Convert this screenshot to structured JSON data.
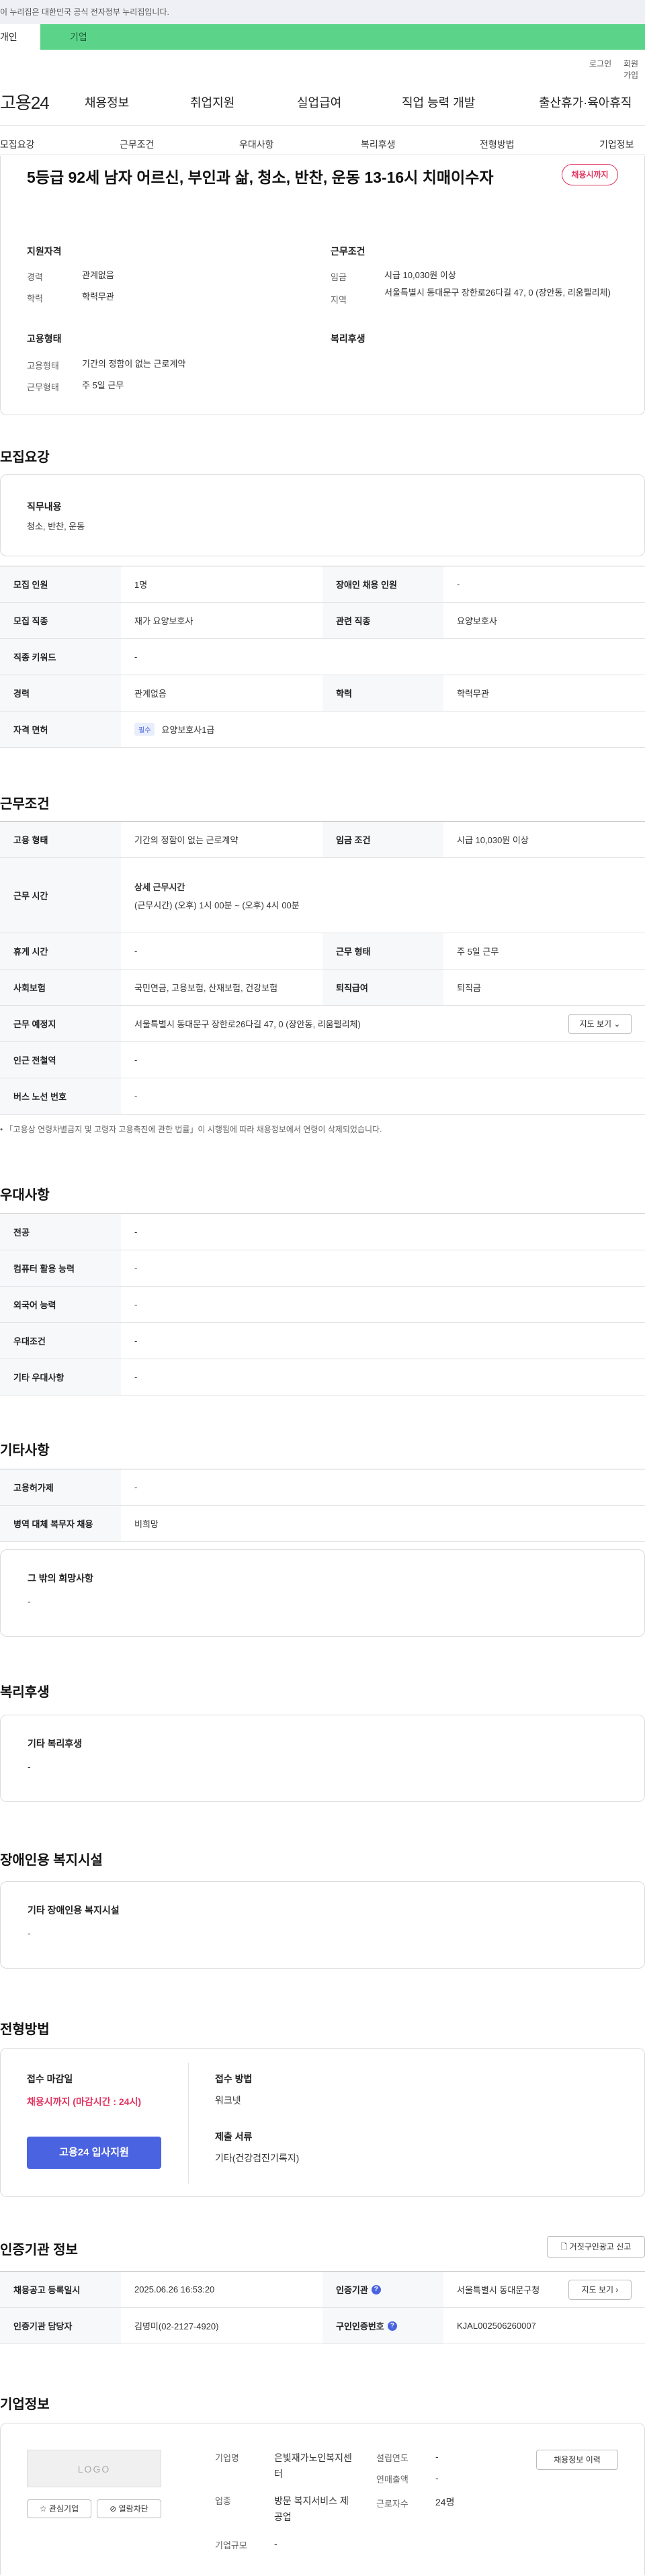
{
  "gov_banner": "이 누리집은 대한민국 공식 전자정부 누리집입니다.",
  "top_tabs": {
    "individual": "개인",
    "business": "기업"
  },
  "util": {
    "login": "로그인",
    "join": "회원가입"
  },
  "logo_text": "고용24",
  "gnb": [
    "채용정보",
    "취업지원",
    "실업급여",
    "직업 능력 개발",
    "출산휴가·육아휴직"
  ],
  "anchors": [
    "모집요강",
    "근무조건",
    "우대사항",
    "복리후생",
    "전형방법",
    "기업정보"
  ],
  "header": {
    "title": "5등급 92세 남자 어르신, 부인과 삶, 청소, 반찬, 운동 13-16시 치매이수자",
    "status_badge": "채용시까지",
    "qualification_title": "지원자격",
    "career_label": "경력",
    "career_value": "관계없음",
    "education_label": "학력",
    "education_value": "학력무관",
    "work_cond_title": "근무조건",
    "wage_label": "임금",
    "wage_value": "시급 10,030원 이상",
    "area_label": "지역",
    "area_value": "서울특별시 동대문구 장한로26다길 47, 0 (장안동, 리움펠리체)",
    "employ_type_title": "고용형태",
    "employ_label": "고용형태",
    "employ_value": "기간의 정함이 없는 근로계약",
    "workform_label": "근무형태",
    "workform_value": "주 5일 근무",
    "welfare_title": "복리후생"
  },
  "recruit": {
    "section": "모집요강",
    "duty_label": "직무내용",
    "duty_value": "청소, 반찬, 운동",
    "rows": [
      {
        "l1": "모집 인원",
        "v1": "1명",
        "l2": "장애인 채용 인원",
        "v2": "-"
      },
      {
        "l1": "모집 직종",
        "v1": "재가 요양보호사",
        "l2": "관련 직종",
        "v2": "요양보호사"
      },
      {
        "l1": "직종 키워드",
        "v1": "-"
      },
      {
        "l1": "경력",
        "v1": "관계없음",
        "l2": "학력",
        "v2": "학력무관"
      },
      {
        "l1": "자격 면허",
        "badge": "필수",
        "v1": "요양보호사1급"
      }
    ]
  },
  "conditions": {
    "section": "근무조건",
    "employ_type_label": "고용 형태",
    "employ_type_value": "기간의 정함이 없는 근로계약",
    "wage_cond_label": "임금 조건",
    "wage_cond_value": "시급 10,030원 이상",
    "hours_label": "근무 시간",
    "hours_detail_title": "상세 근무시간",
    "hours_detail_value": "(근무시간) (오후) 1시 00분 ~ (오후) 4시 00분",
    "rest_label": "휴게 시간",
    "rest_value": "-",
    "workform_label": "근무 형태",
    "workform_value": "주 5일 근무",
    "insurance_label": "사회보험",
    "insurance_value": "국민연금, 고용보험, 산재보험, 건강보험",
    "severance_label": "퇴직급여",
    "severance_value": "퇴직금",
    "location_label": "근무 예정지",
    "location_value": "서울특별시 동대문구 장한로26다길 47, 0 (장안동, 리움펠리체)",
    "map_button": "지도 보기",
    "subway_label": "인근 전철역",
    "subway_value": "-",
    "bus_label": "버스 노선 번호",
    "bus_value": "-",
    "note": "「고용상 연령차별금지 및 고령자 고용촉진에 관한 법률」이 시행됨에 따라 채용정보에서 연령이 삭제되었습니다."
  },
  "preference": {
    "section": "우대사항",
    "rows": [
      {
        "l": "전공",
        "v": "-"
      },
      {
        "l": "컴퓨터 활용 능력",
        "v": "-"
      },
      {
        "l": "외국어 능력",
        "v": "-"
      },
      {
        "l": "우대조건",
        "v": "-"
      },
      {
        "l": "기타 우대사항",
        "v": "-"
      }
    ]
  },
  "etc": {
    "section": "기타사항",
    "rows": [
      {
        "l": "고용허가제",
        "v": "-"
      },
      {
        "l": "병역 대체 복무자 채용",
        "v": "비희망"
      }
    ],
    "other_label": "그 밖의 희망사항",
    "other_value": "-"
  },
  "welfare": {
    "section": "복리후생",
    "label": "기타 복리후생",
    "value": "-"
  },
  "disabled": {
    "section": "장애인용 복지시설",
    "label": "기타 장애인용 복지시설",
    "value": "-"
  },
  "selection": {
    "section": "전형방법",
    "deadline_label": "접수 마감일",
    "deadline_value": "채용시까지 (마감시간 : 24시)",
    "method_label": "접수 방법",
    "method_value": "워크넷",
    "docs_label": "제출 서류",
    "docs_value": "기타(건강검진기록지)",
    "apply_button": "고용24 입사지원"
  },
  "cert": {
    "section": "인증기관 정보",
    "report_button": "거짓구인광고 신고",
    "reg_date_label": "채용공고 등록일시",
    "reg_date_value": "2025.06.26 16:53:20",
    "agency_label": "인증기관",
    "agency_value": "서울특별시 동대문구청",
    "map_button": "지도 보기",
    "manager_label": "인증기관 담당자",
    "manager_value": "김명미(02-2127-4920)",
    "reqno_label": "구인인증번호",
    "reqno_value": "KJAL002506260007"
  },
  "company": {
    "section": "기업정보",
    "logo_placeholder": "LOGO",
    "interest_button": "관심기업",
    "block_button": "열람차단",
    "name_label": "기업명",
    "name_value": "은빛재가노인복지센터",
    "industry_label": "업종",
    "industry_value": "방문 복지서비스 제공업",
    "scale_label": "기업규모",
    "scale_value": "-",
    "founded_label": "설립연도",
    "founded_value": "-",
    "sales_label": "연매출액",
    "sales_value": "-",
    "employees_label": "근로자수",
    "employees_value": "24명",
    "history_button": "채용정보 이력"
  }
}
